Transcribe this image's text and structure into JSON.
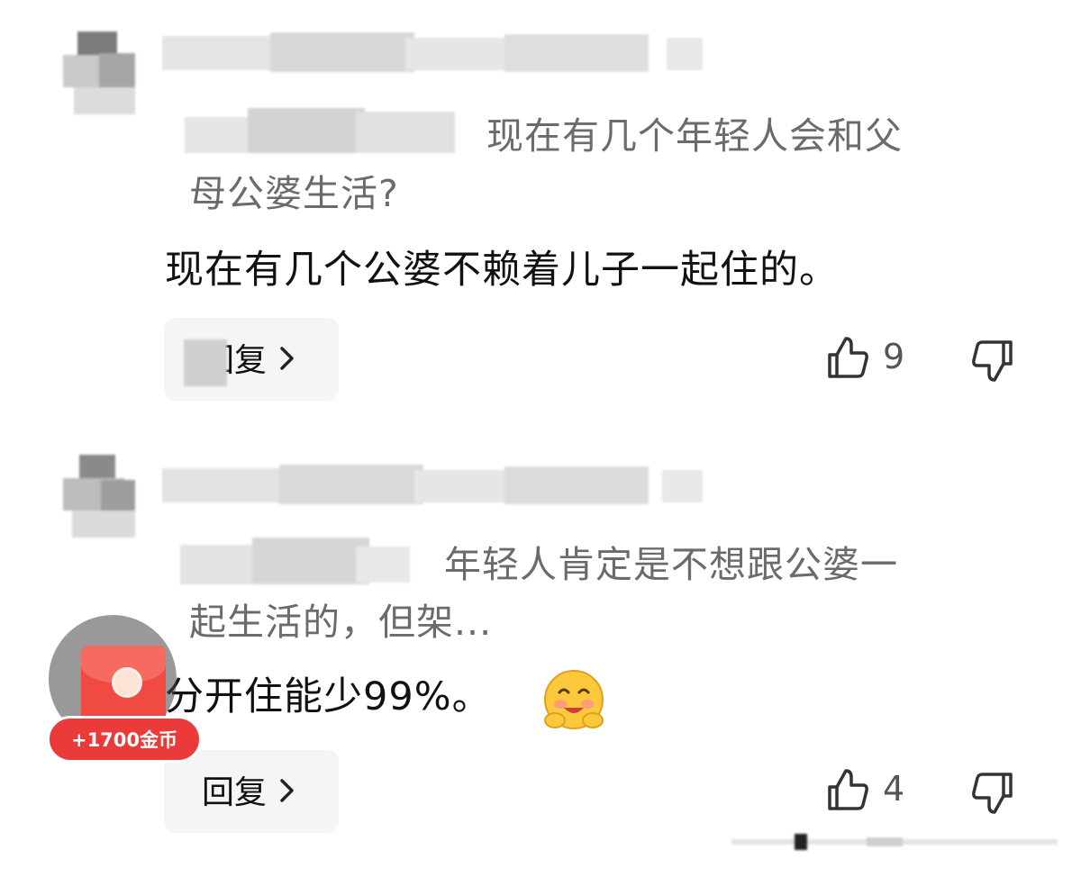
{
  "comments": [
    {
      "quote_text": "现在有几个年轻人会和父母公婆生活?",
      "quote_line1": "现在有几个年轻人会和父",
      "quote_line2": "母公婆生活?",
      "text": "现在有几个公婆不赖着儿子一起住的。",
      "reply_label": "回复",
      "likes": "9"
    },
    {
      "quote_text": "年轻人肯定是不想跟公婆一起生活的，但架...",
      "quote_line1": "年轻人肯定是不想跟公婆一",
      "quote_line2": "起生活的，但架...",
      "text": "分开住能少99%。",
      "emoji": "hugging-face-emoji",
      "reply_label": "回复",
      "likes": "4"
    }
  ],
  "reward_badge": {
    "label": "+1700金币",
    "icon": "red-envelope-icon"
  },
  "colors": {
    "quote_text": "#6b6b6b",
    "body_text": "#111111",
    "reply_bg": "#f5f5f5",
    "badge": "#ea3a3a",
    "envelope": "#f04a42"
  }
}
